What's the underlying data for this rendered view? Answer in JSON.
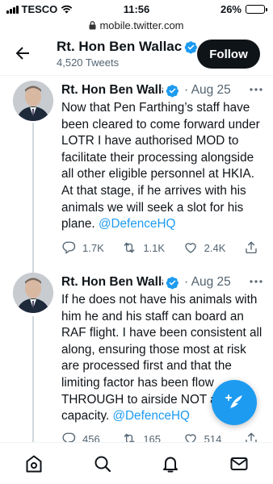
{
  "status_bar": {
    "carrier": "TESCO",
    "time": "11:56",
    "battery": "26%",
    "battery_level": 0.26
  },
  "browser": {
    "url": "mobile.twitter.com"
  },
  "header": {
    "name": "Rt. Hon Ben Wallace",
    "tweet_count": "4,520 Tweets",
    "follow_label": "Follow"
  },
  "tweets": [
    {
      "author": "Rt. Hon Ben Wallace",
      "time": "· Aug 25",
      "text": "Now that Pen Farthing’s staff have been cleared to come forward under LOTR I have authorised MOD to facilitate their processing alongside all other eligible personnel at HKIA. At that stage, if he arrives with his animals we will seek a slot for his plane. ",
      "mention": "@DefenceHQ",
      "replies": "1.7K",
      "retweets": "1.1K",
      "likes": "2.4K"
    },
    {
      "author": "Rt. Hon Ben Wallace",
      "time": "· Aug 25",
      "text": "If he does not have his animals with him he and his staff can board an RAF flight. I have been consistent all along, ensuring those most at risk are processed first and that the limiting factor has been flow THROUGH to airside NOT air capacity. ",
      "mention": "@DefenceHQ",
      "replies": "456",
      "retweets": "165",
      "likes": "514"
    }
  ],
  "colors": {
    "accent": "#1d9bf0",
    "text": "#0f1419",
    "secondary": "#536471",
    "thread_line": "#cfd9de"
  },
  "icons": {
    "back": "arrow-left-icon",
    "verified": "verified-badge-icon",
    "more": "more-dots-icon",
    "reply": "reply-icon",
    "retweet": "retweet-icon",
    "like": "heart-icon",
    "share": "share-icon",
    "compose": "compose-tweet-icon",
    "home": "home-icon",
    "search": "search-icon",
    "notifications": "bell-icon",
    "messages": "mail-icon"
  }
}
